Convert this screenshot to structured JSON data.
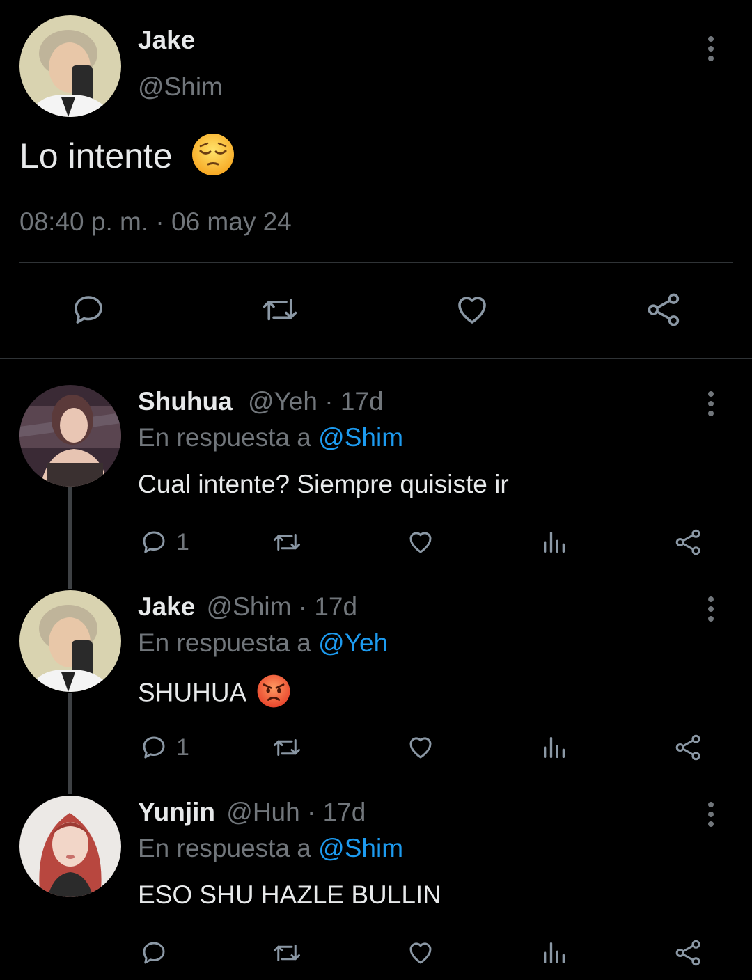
{
  "main_tweet": {
    "display_name": "Jake",
    "handle": "@Shim",
    "text": "Lo intente",
    "timestamp": "08:40 p. m. · 06 may 24",
    "emoji": "pensive-face"
  },
  "replies": [
    {
      "display_name": "Shuhua",
      "handle_time": "@Yeh · 17d",
      "reply_prefix": "En respuesta a",
      "reply_to": "@Shim",
      "text": "Cual intente? Siempre quisiste ir",
      "reply_count": "1"
    },
    {
      "display_name": "Jake",
      "handle_time": "@Shim · 17d",
      "reply_prefix": "En respuesta a",
      "reply_to": "@Yeh",
      "text": "SHUHUA",
      "emoji": "angry-face",
      "reply_count": "1"
    },
    {
      "display_name": "Yunjin",
      "handle_time": "@Huh · 17d",
      "reply_prefix": "En respuesta a",
      "reply_to": "@Shim",
      "text": "ESO SHU HAZLE BULLIN",
      "reply_count": ""
    }
  ],
  "colors": {
    "background": "#000000",
    "text": "#e7e9ea",
    "muted": "#71767b",
    "link": "#1d9bf0",
    "divider": "#2f3336"
  }
}
